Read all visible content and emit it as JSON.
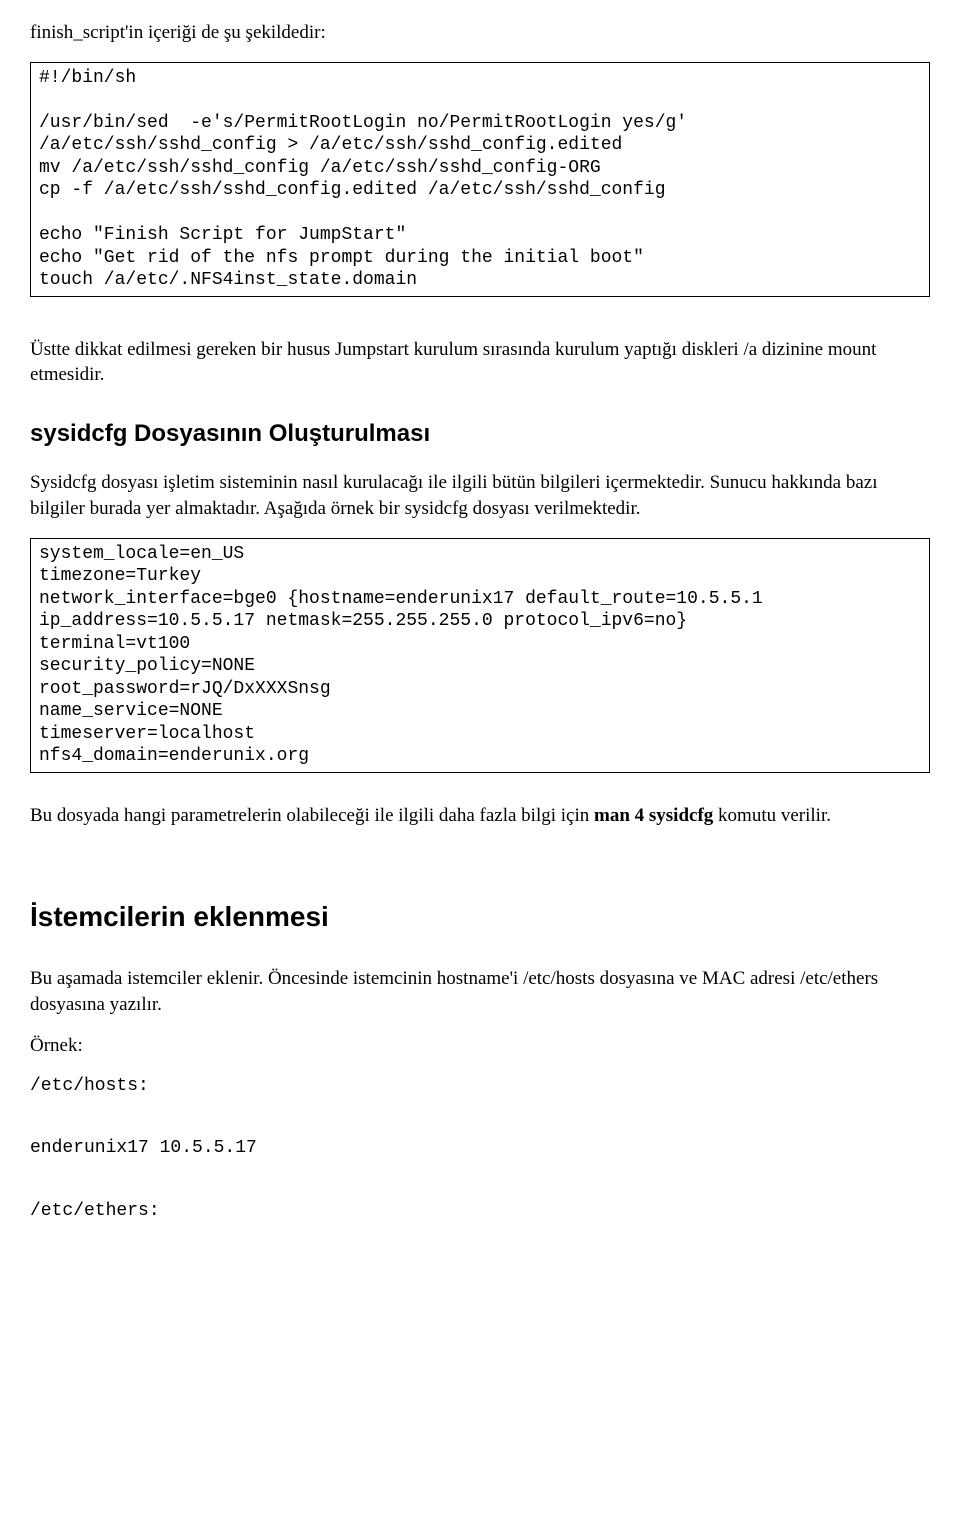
{
  "intro_line": "finish_script'in içeriği de şu şekildedir:",
  "codebox1": "#!/bin/sh\n\n/usr/bin/sed  -e's/PermitRootLogin no/PermitRootLogin yes/g' /a/etc/ssh/sshd_config > /a/etc/ssh/sshd_config.edited\nmv /a/etc/ssh/sshd_config /a/etc/ssh/sshd_config-ORG\ncp -f /a/etc/ssh/sshd_config.edited /a/etc/ssh/sshd_config\n\necho \"Finish Script for JumpStart\"\necho \"Get rid of the nfs prompt during the initial boot\"\ntouch /a/etc/.NFS4inst_state.domain",
  "para1": "Üstte dikkat edilmesi gereken bir husus Jumpstart kurulum sırasında kurulum yaptığı diskleri /a dizinine mount etmesidir.",
  "heading1": "sysidcfg Dosyasının Oluşturulması",
  "para2": "Sysidcfg dosyası işletim sisteminin nasıl kurulacağı ile ilgili bütün bilgileri içermektedir. Sunucu hakkında bazı bilgiler burada yer almaktadır. Aşağıda örnek bir sysidcfg dosyası verilmektedir.",
  "codebox2": "system_locale=en_US\ntimezone=Turkey\nnetwork_interface=bge0 {hostname=enderunix17 default_route=10.5.5.1 ip_address=10.5.5.17 netmask=255.255.255.0 protocol_ipv6=no}\nterminal=vt100\nsecurity_policy=NONE\nroot_password=rJQ/DxXXXSnsg\nname_service=NONE\ntimeserver=localhost\nnfs4_domain=enderunix.org",
  "para3_before_bold": "Bu dosyada hangi parametrelerin olabileceği ile ilgili daha fazla bilgi için ",
  "para3_bold": "man 4 sysidcfg",
  "para3_after_bold": " komutu verilir.",
  "heading2": "İstemcilerin eklenmesi",
  "para4": "Bu aşamada istemciler eklenir. Öncesinde istemcinin hostname'i /etc/hosts dosyasına ve MAC adresi /etc/ethers dosyasına yazılır.",
  "example_label": "Örnek:",
  "hosts_label": "/etc/hosts:",
  "hosts_content": "enderunix17  10.5.5.17",
  "ethers_label": "/etc/ethers:"
}
